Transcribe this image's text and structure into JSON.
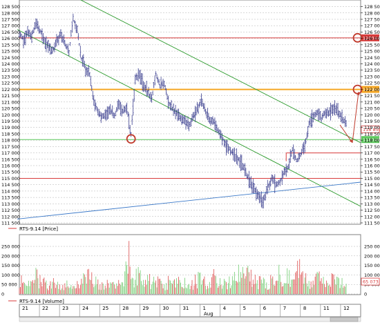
{
  "colors": {
    "bar": "#3b3f8f",
    "green_line": "#2a9a2a",
    "blue_line": "#3a78c8",
    "resistance_red": "#d83a3a",
    "resistance_orange": "#f5a623",
    "support_green": "#5ec95e",
    "circle": "#c0392b",
    "arrow_red": "#c0392b",
    "vol_up": "#7fd17f",
    "vol_down": "#e06060",
    "grid": "#b0b0b0"
  },
  "chart_data": [
    {
      "type": "line",
      "subtype": "ohlc-bars",
      "series_label": "RTS-9.14 [Price]",
      "ylim": [
        111500,
        128800
      ],
      "y_ticks": [
        111500,
        112000,
        112500,
        113000,
        113500,
        114000,
        114500,
        115000,
        115500,
        116000,
        116500,
        117000,
        117500,
        118000,
        118500,
        119000,
        119500,
        120000,
        120500,
        121000,
        121500,
        122000,
        122500,
        123000,
        123500,
        124000,
        124500,
        125000,
        125500,
        126000,
        126500,
        127000,
        127500,
        128000,
        128500
      ],
      "y_tick_labels": [
        "111 500",
        "112 000",
        "112 500",
        "113 000",
        "113 500",
        "114 000",
        "114 500",
        "115 000",
        "115 500",
        "116 000",
        "116 500",
        "117 000",
        "117 500",
        "118 000",
        "118 500",
        "119 000",
        "119 500",
        "120 000",
        "120 500",
        "121 000",
        "121 500",
        "122 000",
        "122 500",
        "123 000",
        "123 500",
        "124 000",
        "124 500",
        "125 000",
        "125 500",
        "126 000",
        "126 500",
        "127 000",
        "127 500",
        "128 000",
        "128 500"
      ],
      "close_path": [
        [
          0,
          126400
        ],
        [
          4,
          125900
        ],
        [
          8,
          126500
        ],
        [
          12,
          126200
        ],
        [
          16,
          127200
        ],
        [
          20,
          126600
        ],
        [
          24,
          125800
        ],
        [
          28,
          125400
        ],
        [
          32,
          125000
        ],
        [
          36,
          125800
        ],
        [
          40,
          126300
        ],
        [
          44,
          125600
        ],
        [
          48,
          124900
        ],
        [
          52,
          127600
        ],
        [
          56,
          126600
        ],
        [
          60,
          124400
        ],
        [
          64,
          123600
        ],
        [
          68,
          123200
        ],
        [
          72,
          121000
        ],
        [
          76,
          120300
        ],
        [
          80,
          119800
        ],
        [
          84,
          120000
        ],
        [
          88,
          120400
        ],
        [
          92,
          119900
        ],
        [
          96,
          120800
        ],
        [
          100,
          120200
        ],
        [
          104,
          120600
        ],
        [
          108,
          118400
        ],
        [
          112,
          122800
        ],
        [
          116,
          123200
        ],
        [
          120,
          122300
        ],
        [
          124,
          121800
        ],
        [
          128,
          121200
        ],
        [
          132,
          123300
        ],
        [
          136,
          122200
        ],
        [
          140,
          122500
        ],
        [
          144,
          121000
        ],
        [
          148,
          120400
        ],
        [
          152,
          120200
        ],
        [
          156,
          119800
        ],
        [
          160,
          119600
        ],
        [
          164,
          119000
        ],
        [
          168,
          119800
        ],
        [
          172,
          120400
        ],
        [
          176,
          121200
        ],
        [
          180,
          120300
        ],
        [
          184,
          119600
        ],
        [
          188,
          119400
        ],
        [
          192,
          118800
        ],
        [
          196,
          118300
        ],
        [
          200,
          117500
        ],
        [
          204,
          117200
        ],
        [
          208,
          116800
        ],
        [
          212,
          116500
        ],
        [
          216,
          116000
        ],
        [
          220,
          115300
        ],
        [
          224,
          114500
        ],
        [
          228,
          114000
        ],
        [
          232,
          113500
        ],
        [
          236,
          113200
        ],
        [
          240,
          114200
        ],
        [
          244,
          115000
        ],
        [
          248,
          114500
        ],
        [
          252,
          114700
        ],
        [
          256,
          115400
        ],
        [
          260,
          115900
        ],
        [
          264,
          117300
        ],
        [
          268,
          116400
        ],
        [
          272,
          116900
        ],
        [
          276,
          117600
        ],
        [
          280,
          119200
        ],
        [
          284,
          119900
        ],
        [
          288,
          120200
        ],
        [
          292,
          119700
        ],
        [
          296,
          120200
        ],
        [
          300,
          120100
        ],
        [
          304,
          120500
        ],
        [
          308,
          120300
        ],
        [
          312,
          119700
        ],
        [
          316,
          119350
        ]
      ],
      "bar_count": 320,
      "horizontal_levels": [
        {
          "price": 126044,
          "label": "126044",
          "color": "#d83a3a"
        },
        {
          "price": 121989,
          "label": "121989",
          "color": "#f5a623"
        },
        {
          "price": 118048,
          "label": "118048",
          "color": "#5ec95e"
        },
        {
          "price": 115000,
          "label": "",
          "color": "#d83a3a"
        }
      ],
      "current_price": {
        "price": 118850,
        "label": "118 850"
      },
      "trend_lines": [
        {
          "name": "upper-channel",
          "x0": 55,
          "p0": 129200,
          "x1": 330,
          "p1": 117800,
          "color": "#2a9a2a"
        },
        {
          "name": "lower-channel",
          "x0": -2,
          "p0": 126700,
          "x1": 330,
          "p1": 112800,
          "color": "#2a9a2a"
        },
        {
          "name": "long-support",
          "x0": -2,
          "p0": 111800,
          "x1": 330,
          "p1": 114700,
          "color": "#3a78c8"
        }
      ],
      "short_red_segment": {
        "x0": 258,
        "x1": 330,
        "price": 117000
      },
      "circle_markers": [
        {
          "x": 108,
          "price": 118100
        },
        {
          "x": 327,
          "price": 126044
        },
        {
          "x": 327,
          "price": 121989
        }
      ],
      "arrows": [
        {
          "from_x": 310,
          "from_price": 119200,
          "to_x": 322,
          "to_price": 117800
        },
        {
          "from_x": 322,
          "from_price": 117800,
          "to_x": 328,
          "to_price": 121800
        }
      ],
      "legend": "top-left"
    },
    {
      "type": "bar",
      "series_label": "RTS-9.14 [Volume]",
      "ylim": [
        0,
        290000
      ],
      "y_ticks": [
        0,
        50000,
        100000,
        150000,
        200000,
        250000
      ],
      "y_tick_labels": [
        "0",
        "50 000",
        "100 000",
        "150 000",
        "200 000",
        "250 000"
      ],
      "current_volume": {
        "value": 65073,
        "label": "65 073"
      },
      "volume_bar_count": 110,
      "volume_profile": [
        [
          0,
          100000
        ],
        [
          5,
          45000
        ],
        [
          10,
          60000
        ],
        [
          15,
          120000
        ],
        [
          20,
          80000
        ],
        [
          25,
          70000
        ],
        [
          30,
          55000
        ],
        [
          35,
          90000
        ],
        [
          40,
          40000
        ],
        [
          45,
          70000
        ],
        [
          50,
          60000
        ],
        [
          55,
          50000
        ],
        [
          60,
          80000
        ],
        [
          65,
          110000
        ],
        [
          70,
          140000
        ],
        [
          75,
          60000
        ],
        [
          80,
          70000
        ],
        [
          85,
          60000
        ],
        [
          90,
          70000
        ],
        [
          95,
          90000
        ],
        [
          100,
          95000
        ],
        [
          105,
          260000
        ],
        [
          110,
          110000
        ],
        [
          115,
          130000
        ],
        [
          120,
          60000
        ],
        [
          125,
          90000
        ],
        [
          130,
          80000
        ],
        [
          135,
          70000
        ],
        [
          140,
          50000
        ],
        [
          145,
          80000
        ],
        [
          150,
          60000
        ],
        [
          155,
          90000
        ],
        [
          160,
          70000
        ],
        [
          165,
          60000
        ],
        [
          170,
          80000
        ],
        [
          175,
          100000
        ],
        [
          180,
          70000
        ],
        [
          185,
          60000
        ],
        [
          190,
          130000
        ],
        [
          195,
          70000
        ],
        [
          200,
          60000
        ],
        [
          205,
          80000
        ],
        [
          210,
          110000
        ],
        [
          215,
          150000
        ],
        [
          220,
          140000
        ],
        [
          225,
          90000
        ],
        [
          230,
          70000
        ],
        [
          235,
          90000
        ],
        [
          240,
          60000
        ],
        [
          245,
          120000
        ],
        [
          250,
          170000
        ],
        [
          255,
          110000
        ],
        [
          260,
          120000
        ],
        [
          265,
          90000
        ],
        [
          270,
          150000
        ],
        [
          275,
          160000
        ],
        [
          280,
          80000
        ],
        [
          285,
          70000
        ],
        [
          290,
          110000
        ],
        [
          295,
          60000
        ],
        [
          300,
          90000
        ],
        [
          305,
          80000
        ],
        [
          310,
          70000
        ],
        [
          315,
          60000
        ]
      ]
    }
  ],
  "x_axis": {
    "labels": [
      "21",
      "22",
      "23",
      "24",
      "25",
      "28",
      "29",
      "30",
      "31",
      "1",
      "4",
      "5",
      "6",
      "7",
      "8",
      "11",
      "12"
    ],
    "month_label": "Aug"
  },
  "legend_price": "RTS-9.14 [Price]",
  "legend_volume": "RTS-9.14 [Volume]"
}
